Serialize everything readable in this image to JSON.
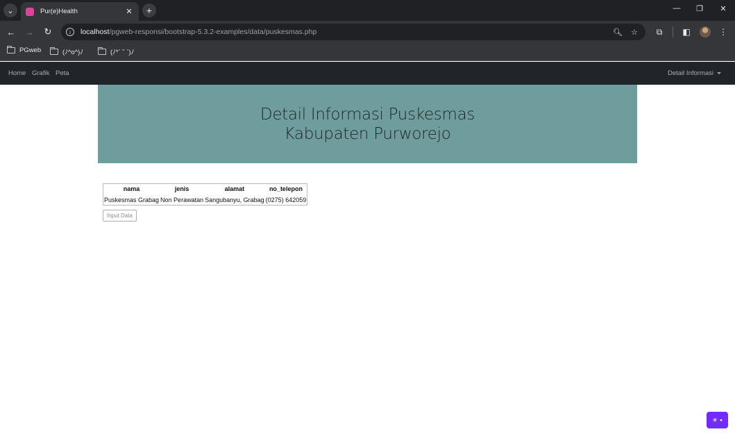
{
  "browser": {
    "tab": {
      "title": "Pur(e)Health"
    },
    "address_bar": {
      "host": "localhost",
      "path": "/pgweb-responsi/bootstrap-5.3.2-examples/data/puskesmas.php"
    },
    "bookmarks": [
      {
        "label": "PGweb"
      },
      {
        "label": "(ﾉ^o^)ﾉ"
      },
      {
        "label": "(ﾉ*´ ˘ `)ﾉ"
      }
    ]
  },
  "navbar": {
    "links": [
      {
        "label": "Home"
      },
      {
        "label": "Grafik"
      },
      {
        "label": "Peta"
      }
    ],
    "dropdown": {
      "label": "Detail Informasi"
    }
  },
  "hero": {
    "title_line1": "Detail Informasi Puskesmas",
    "title_line2": "Kabupaten Purworejo",
    "background": "#6f9c9c"
  },
  "table": {
    "headers": [
      "nama",
      "jenis",
      "alamat",
      "no_telepon"
    ],
    "rows": [
      [
        "Puskesmas Grabag",
        "Non Perawatan",
        "Sangubanyu, Grabag",
        "(0275) 642059"
      ]
    ]
  },
  "actions": {
    "input_button_label": "Input Data"
  },
  "theme_toggle": {
    "icon": "sun-icon",
    "color": "#712cf9"
  }
}
